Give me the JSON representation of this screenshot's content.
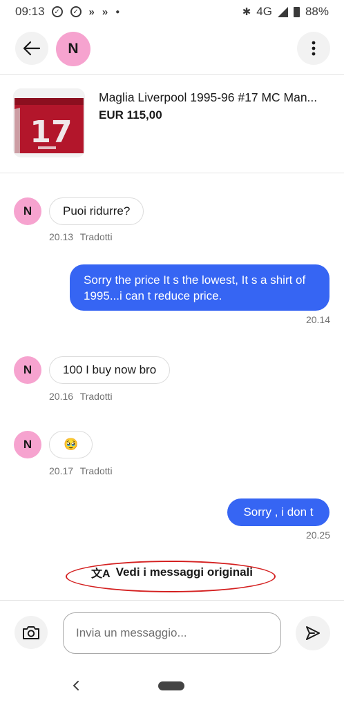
{
  "status_bar": {
    "time": "09:13",
    "network": "4G",
    "battery": "88%"
  },
  "header": {
    "avatar_letter": "N"
  },
  "item": {
    "title": "Maglia Liverpool  1995-96 #17 MC Man...",
    "price": "EUR 115,00"
  },
  "messages": [
    {
      "direction": "in",
      "avatar": "N",
      "text": "Puoi ridurre?",
      "time": "20.13",
      "translated_label": "Tradotti"
    },
    {
      "direction": "out",
      "text": "Sorry the price It s the lowest, It s a shirt of 1995...i can t reduce price.",
      "time": "20.14"
    },
    {
      "direction": "in",
      "avatar": "N",
      "text": "100 I buy now bro",
      "time": "20.16",
      "translated_label": "Tradotti"
    },
    {
      "direction": "in",
      "avatar": "N",
      "text": "🥹",
      "time": "20.17",
      "translated_label": "Tradotti"
    },
    {
      "direction": "out",
      "text": "Sorry , i don t",
      "time": "20.25"
    }
  ],
  "translate": {
    "label": "Vedi i messaggi originali"
  },
  "composer": {
    "placeholder": "Invia un messaggio..."
  },
  "colors": {
    "accent": "#3665f3",
    "avatar_bg": "#f6a3cf",
    "highlight_oval": "#d42020"
  }
}
